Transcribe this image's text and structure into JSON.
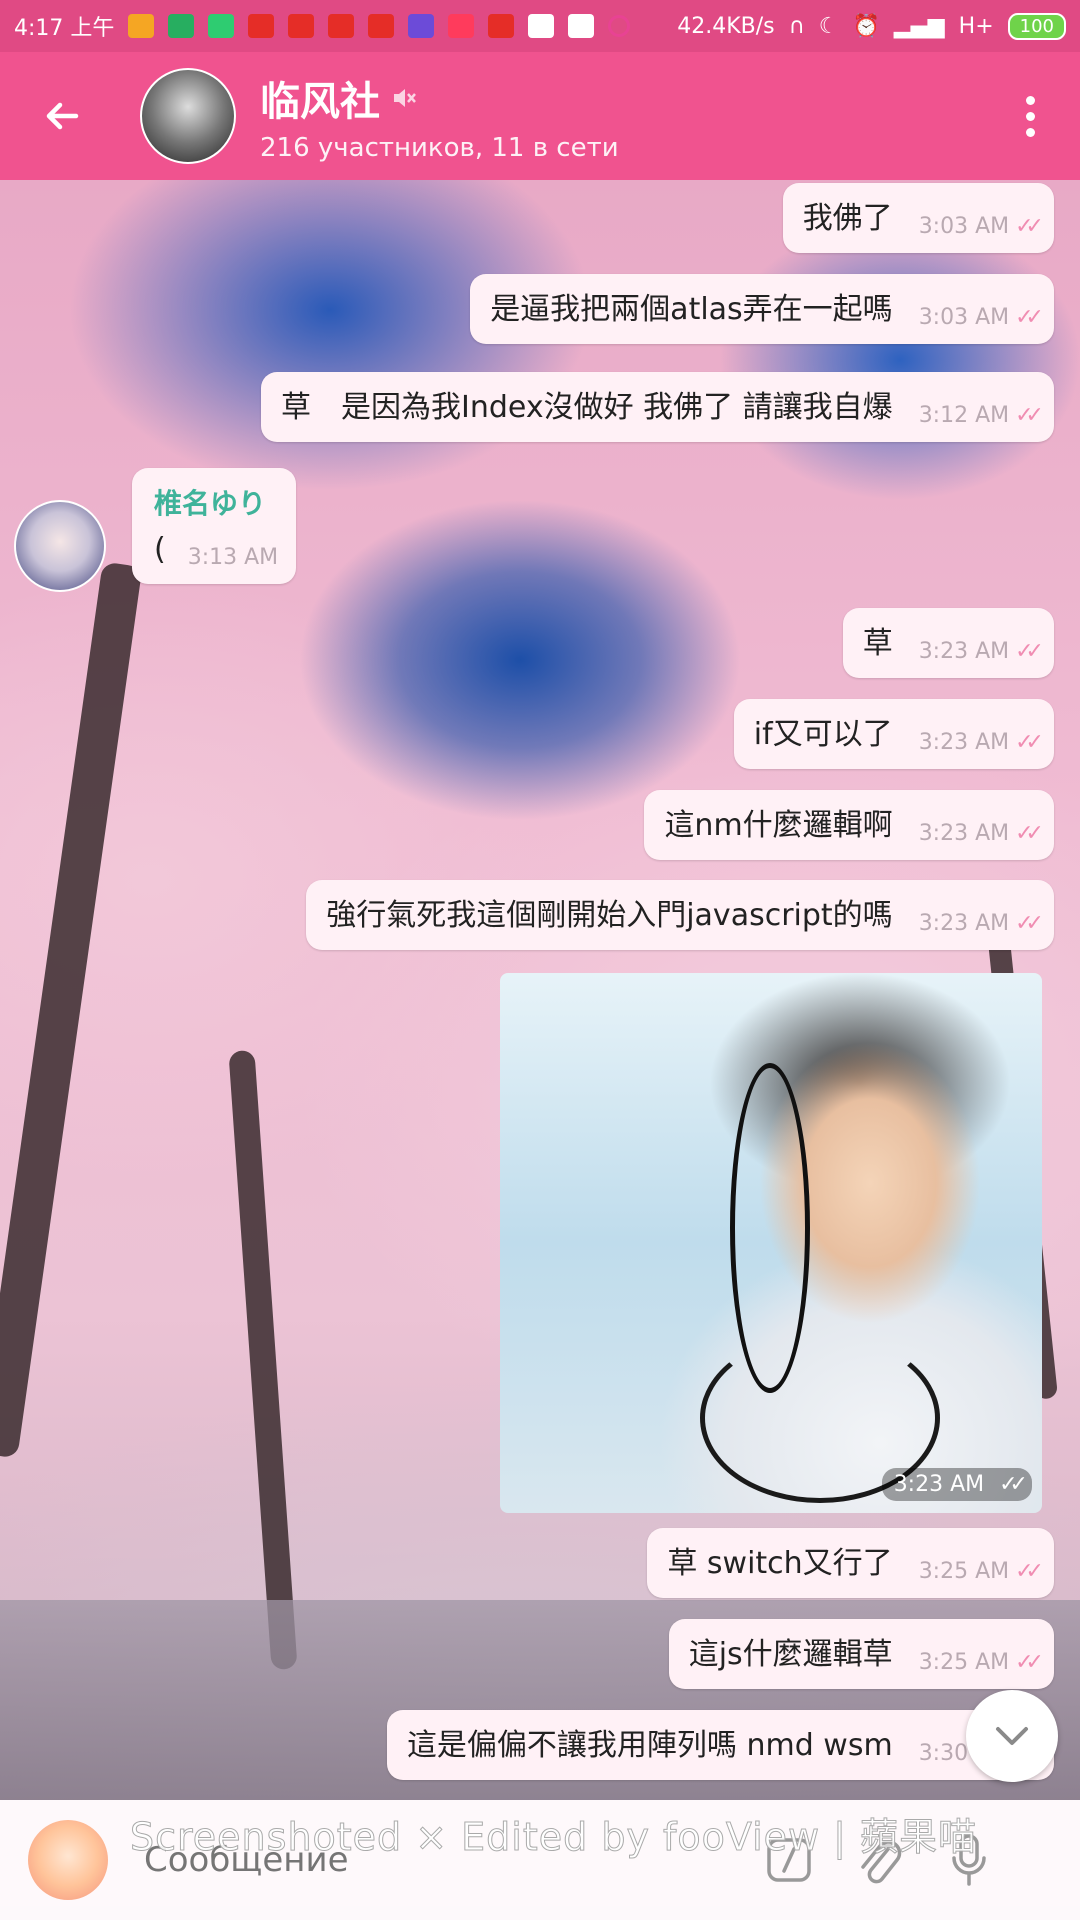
{
  "status_bar": {
    "time": "4:17 上午",
    "network_speed": "42.4KB/s",
    "signal": "H+",
    "battery": "100"
  },
  "header": {
    "title": "临风社",
    "subtitle": "216 участников, 11 в сети"
  },
  "messages": [
    {
      "text": "我佛了",
      "time": "3:03 AM"
    },
    {
      "text": "是逼我把兩個atlas弄在一起嗎",
      "time": "3:03 AM"
    },
    {
      "text": "草　是因為我Index沒做好 我佛了 請讓我自爆",
      "time": "3:12 AM"
    },
    {
      "sender": "椎名ゆり",
      "text": "(",
      "time": "3:13 AM"
    },
    {
      "text": "草",
      "time": "3:23 AM"
    },
    {
      "text": "if又可以了",
      "time": "3:23 AM"
    },
    {
      "text": "這nm什麼邏輯啊",
      "time": "3:23 AM"
    },
    {
      "text": "強行氣死我這個剛開始入門javascript的嗎",
      "time": "3:23 AM"
    },
    {
      "photo": true,
      "time": "3:23 AM"
    },
    {
      "text": "草 switch又行了",
      "time": "3:25 AM"
    },
    {
      "text": "這js什麼邏輯草",
      "time": "3:25 AM"
    },
    {
      "text": "這是偏偏不讓我用陣列嗎 nmd wsm",
      "time": "3:30 AM"
    }
  ],
  "input": {
    "placeholder": "Сообщение"
  },
  "watermark": "Screenshoted × Edited by fooView | 蘋果喵",
  "colors": {
    "status_bar": "#e04a84",
    "app_bar": "#f0538f",
    "bubble": "#fff1f6",
    "sender_name": "#3fb39a",
    "read_check": "#f08db2"
  },
  "icons": [
    "back-arrow-icon",
    "muted-icon",
    "more-vert-icon",
    "double-check-icon",
    "chevron-down-icon",
    "sticker-icon",
    "command-icon",
    "attach-icon",
    "mic-icon"
  ]
}
